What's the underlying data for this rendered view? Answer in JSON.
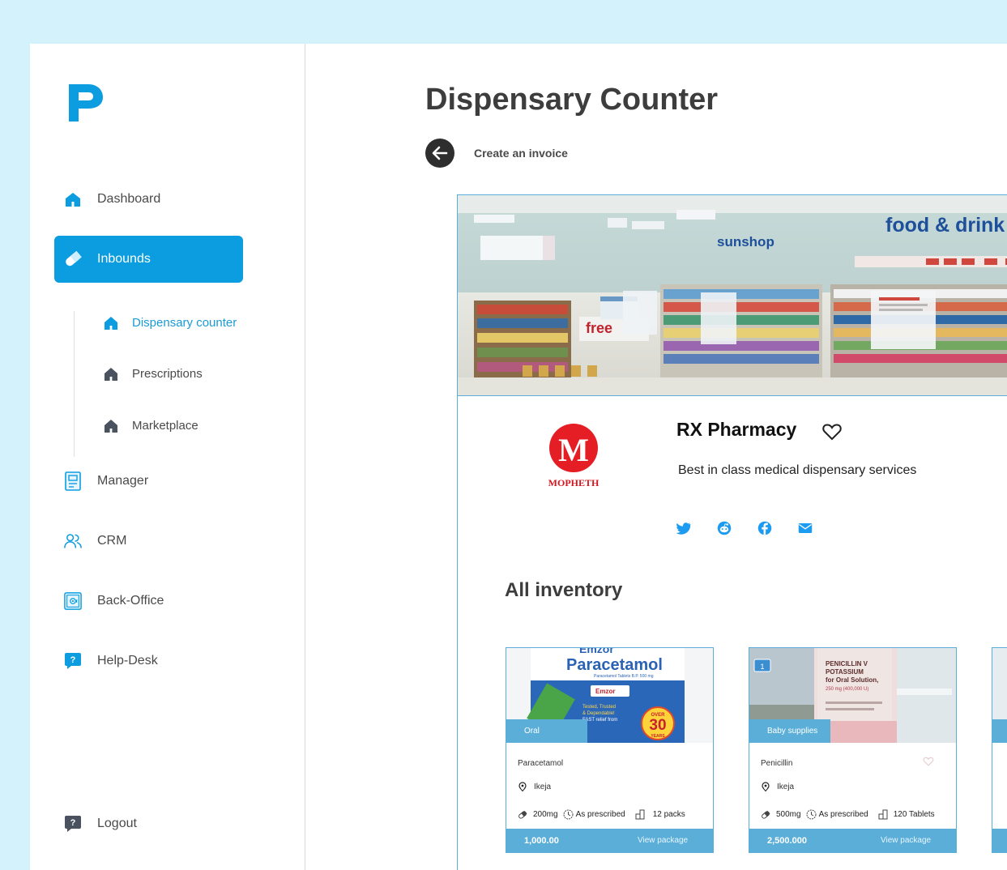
{
  "sidebar": {
    "items": [
      {
        "label": "Dashboard",
        "icon": "home-icon"
      },
      {
        "label": "Inbounds",
        "icon": "pill-icon",
        "active": true
      },
      {
        "label": "Manager",
        "icon": "ledger-icon"
      },
      {
        "label": "CRM",
        "icon": "users-icon"
      },
      {
        "label": "Back-Office",
        "icon": "safe-icon"
      },
      {
        "label": "Help-Desk",
        "icon": "help-chat-icon"
      }
    ],
    "sub_items": [
      {
        "label": "Dispensary counter",
        "active": true
      },
      {
        "label": "Prescriptions"
      },
      {
        "label": "Marketplace"
      }
    ],
    "logout_label": "Logout"
  },
  "header": {
    "title": "Dispensary Counter",
    "back_label": "Create an invoice"
  },
  "store": {
    "banner_texts": {
      "sign1": "food & drink",
      "sign2": "sunshop",
      "sign3": "free"
    },
    "logo_letter": "M",
    "logo_text": "MOPHETH",
    "name": "RX Pharmacy",
    "description": "Best in class medical dispensary services",
    "socials": [
      "twitter-icon",
      "reddit-icon",
      "facebook-icon",
      "mail-icon"
    ]
  },
  "inventory": {
    "title": "All inventory",
    "products": [
      {
        "category": "Oral",
        "name": "Paracetamol",
        "location": "Ikeja",
        "dose": "200mg",
        "usage": "As prescribed",
        "quantity": "12 packs",
        "price": "1,000.00",
        "action": "View package",
        "image_texts": {
          "brand": "Emzor",
          "title": "Paracetamol",
          "sub": "Paracetamol Tablets B.P. 500 mg",
          "badge_top": "OVER",
          "badge_num": "30",
          "badge_bottom": "YEARS"
        }
      },
      {
        "category": "Baby supplies",
        "name": "Penicillin",
        "location": "Ikeja",
        "dose": "500mg",
        "usage": "As prescribed",
        "quantity": "120 Tablets",
        "price": "2,500.000",
        "action": "View package",
        "image_texts": {
          "count": "1",
          "label_line1": "PENICILLIN V",
          "label_line2": "POTASSIUM",
          "label_line3": "for Oral Solution,",
          "label_line4": "250 mg (400,000 U)"
        }
      }
    ]
  },
  "colors": {
    "accent": "#0b9de0",
    "card_blue": "#5aaed8",
    "background": "#d3f2fc"
  }
}
